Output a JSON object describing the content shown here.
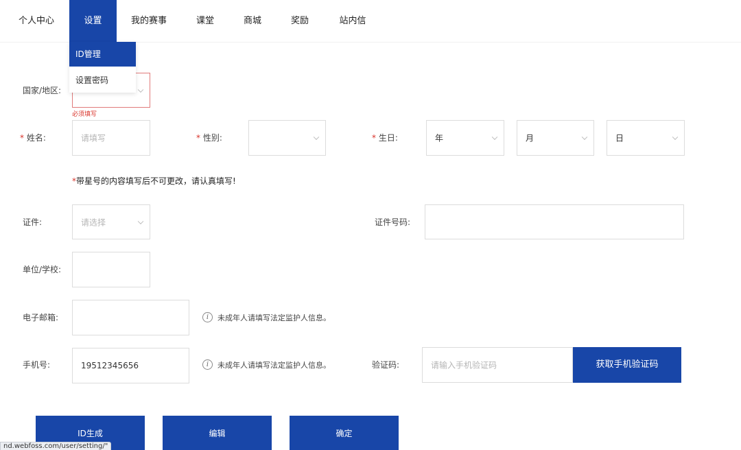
{
  "nav": {
    "items": [
      "个人中心",
      "设置",
      "我的赛事",
      "课堂",
      "商城",
      "奖励",
      "站内信"
    ],
    "active_index": 1
  },
  "dropdown": {
    "items": [
      "ID管理",
      "设置密码"
    ]
  },
  "form": {
    "country": {
      "label": "国家/地区:",
      "error": "必须填写"
    },
    "name": {
      "required_mark": "*",
      "label": "姓名:",
      "placeholder": "请填写"
    },
    "gender": {
      "required_mark": "*",
      "label": "性别:"
    },
    "birthday": {
      "required_mark": "*",
      "label": "生日:",
      "year": "年",
      "month": "月",
      "day": "日"
    },
    "notice": {
      "mark": "*",
      "text": "带星号的内容填写后不可更改，请认真填写!"
    },
    "id_type": {
      "label": "证件:",
      "placeholder": "请选择"
    },
    "id_number": {
      "label": "证件号码:"
    },
    "school": {
      "label": "单位/学校:"
    },
    "email": {
      "label": "电子邮箱:",
      "hint": "未成年人请填写法定监护人信息。"
    },
    "phone": {
      "label": "手机号:",
      "value": "19512345656",
      "hint": "未成年人请填写法定监护人信息。"
    },
    "code": {
      "label": "验证码:",
      "placeholder": "请输入手机验证码",
      "button": "获取手机验证码"
    }
  },
  "actions": {
    "generate": "ID生成",
    "edit": "编辑",
    "confirm": "确定"
  },
  "status_url": "nd.webfoss.com/user/setting/\""
}
